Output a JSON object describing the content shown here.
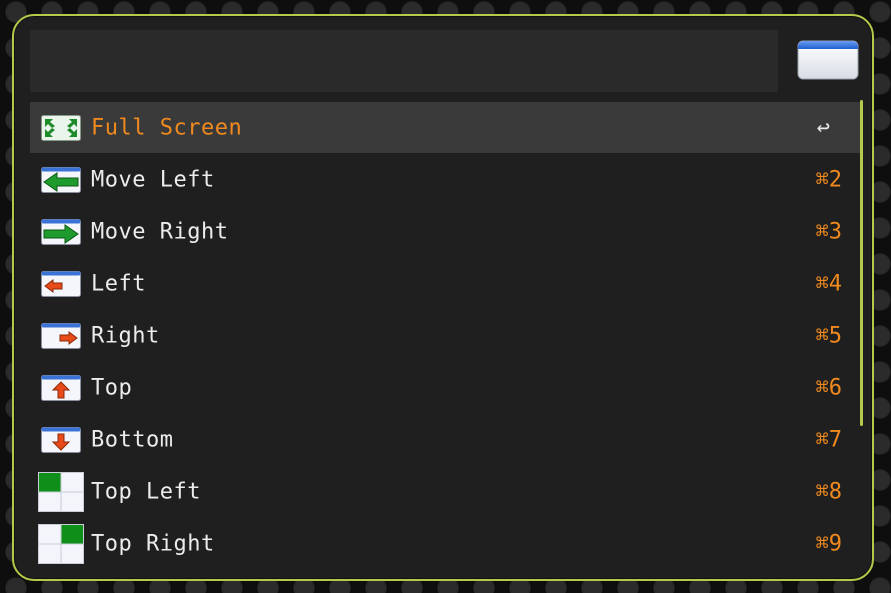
{
  "search": {
    "value": "",
    "placeholder": ""
  },
  "header": {
    "window_icon": "window-icon"
  },
  "colors": {
    "accent": "#f08a1e",
    "border": "#b6c94a",
    "panel": "#1f1f1f",
    "selected_row": "#3a3a3a"
  },
  "items": [
    {
      "label": "Full Screen",
      "shortcut": "↩",
      "icon": "full-screen-icon",
      "selected": true
    },
    {
      "label": "Move Left",
      "shortcut": "⌘2",
      "icon": "move-left-icon"
    },
    {
      "label": "Move Right",
      "shortcut": "⌘3",
      "icon": "move-right-icon"
    },
    {
      "label": "Left",
      "shortcut": "⌘4",
      "icon": "left-half-icon"
    },
    {
      "label": "Right",
      "shortcut": "⌘5",
      "icon": "right-half-icon"
    },
    {
      "label": "Top",
      "shortcut": "⌘6",
      "icon": "top-half-icon"
    },
    {
      "label": "Bottom",
      "shortcut": "⌘7",
      "icon": "bottom-half-icon"
    },
    {
      "label": "Top Left",
      "shortcut": "⌘8",
      "icon": "top-left-quarter-icon"
    },
    {
      "label": "Top Right",
      "shortcut": "⌘9",
      "icon": "top-right-quarter-icon"
    }
  ]
}
